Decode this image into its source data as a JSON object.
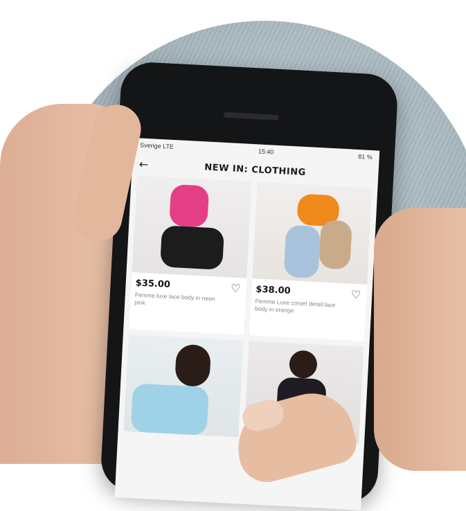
{
  "status_bar": {
    "carrier": "Sverige LTE",
    "time": "15:40",
    "battery": "81 %"
  },
  "nav": {
    "back_icon": "back-arrow-icon",
    "title": "NEW IN: CLOTHING"
  },
  "products": [
    {
      "price": "$35.00",
      "description": "Femme luxe lace body in neon pink",
      "heart_icon": "heart-icon"
    },
    {
      "price": "$38.00",
      "description": "Femme Luxe corset detail lace body in orange",
      "heart_icon": "heart-icon"
    },
    {
      "price": "",
      "description": "",
      "heart_icon": ""
    },
    {
      "price": "",
      "description": "",
      "heart_icon": ""
    }
  ],
  "colors": {
    "accent_pink": "#e43f86",
    "accent_orange": "#f08a1c",
    "screen_bg": "#f5f5f5"
  }
}
